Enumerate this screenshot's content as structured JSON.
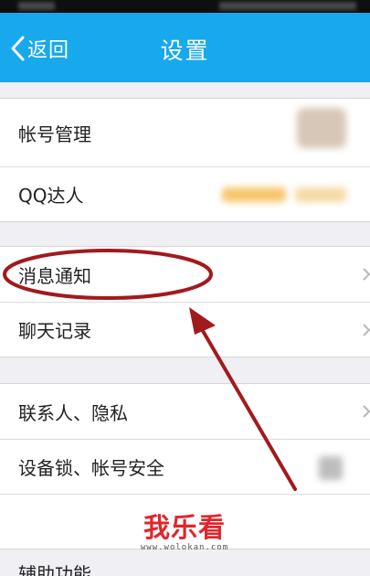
{
  "header": {
    "back_label": "返回",
    "title": "设置"
  },
  "groups": [
    {
      "items": [
        {
          "label": "帐号管理"
        },
        {
          "label": "QQ达人"
        }
      ]
    },
    {
      "items": [
        {
          "label": "消息通知"
        },
        {
          "label": "聊天记录"
        }
      ]
    },
    {
      "items": [
        {
          "label": "联系人、隐私"
        },
        {
          "label": "设备锁、帐号安全"
        },
        {
          "label": ""
        }
      ]
    }
  ],
  "partial_row": {
    "label": "辅助功能"
  },
  "watermark": {
    "logo_text": "我乐看",
    "url_text": "www.wolokan.com"
  },
  "colors": {
    "navbar": "#17a9ec",
    "background": "#efeff4",
    "annotation": "#a11a1e",
    "watermark": "#e0262b"
  },
  "icons": {
    "back": "chevron-left-icon",
    "row_arrow": "chevron-right-icon"
  }
}
